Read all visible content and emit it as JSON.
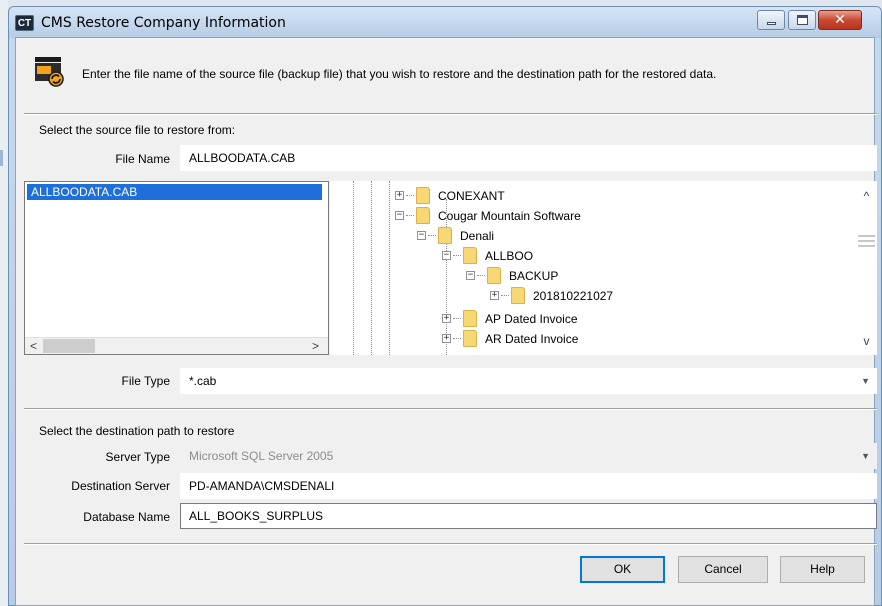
{
  "window": {
    "app_badge": "CT",
    "title": "CMS Restore Company Information"
  },
  "header": {
    "text": "Enter the file name of the source file (backup file) that you wish to restore and the destination path for the restored data."
  },
  "source": {
    "section_label": "Select the source file to restore from:",
    "file_name_label": "File Name",
    "file_name_value": "ALLBOODATA.CAB",
    "files": [
      "ALLBOODATA.CAB"
    ],
    "file_type_label": "File Type",
    "file_type_value": "*.cab"
  },
  "tree": {
    "nodes": [
      {
        "label": "CONEXANT",
        "expander": "+"
      },
      {
        "label": "Cougar Mountain Software",
        "expander": "−"
      },
      {
        "label": "Denali",
        "expander": "−"
      },
      {
        "label": "ALLBOO",
        "expander": "−"
      },
      {
        "label": "BACKUP",
        "expander": "−"
      },
      {
        "label": "201810221027",
        "expander": "+"
      },
      {
        "label": "AP Dated Invoice",
        "expander": "+"
      },
      {
        "label": "AR Dated Invoice",
        "expander": "+"
      }
    ]
  },
  "destination": {
    "section_label": "Select the destination path to restore",
    "server_type_label": "Server Type",
    "server_type_value": "Microsoft SQL Server 2005",
    "destination_server_label": "Destination Server",
    "destination_server_value": "PD-AMANDA\\CMSDENALI",
    "database_name_label": "Database Name",
    "database_name_value": "ALL_BOOKS_SURPLUS"
  },
  "buttons": {
    "ok": "OK",
    "cancel": "Cancel",
    "help": "Help"
  },
  "icons": {
    "window_minimize": "minimize-icon",
    "window_maximize": "maximize-icon",
    "window_close": "close-icon",
    "header": "restore-database-icon",
    "folder": "folder-icon"
  }
}
